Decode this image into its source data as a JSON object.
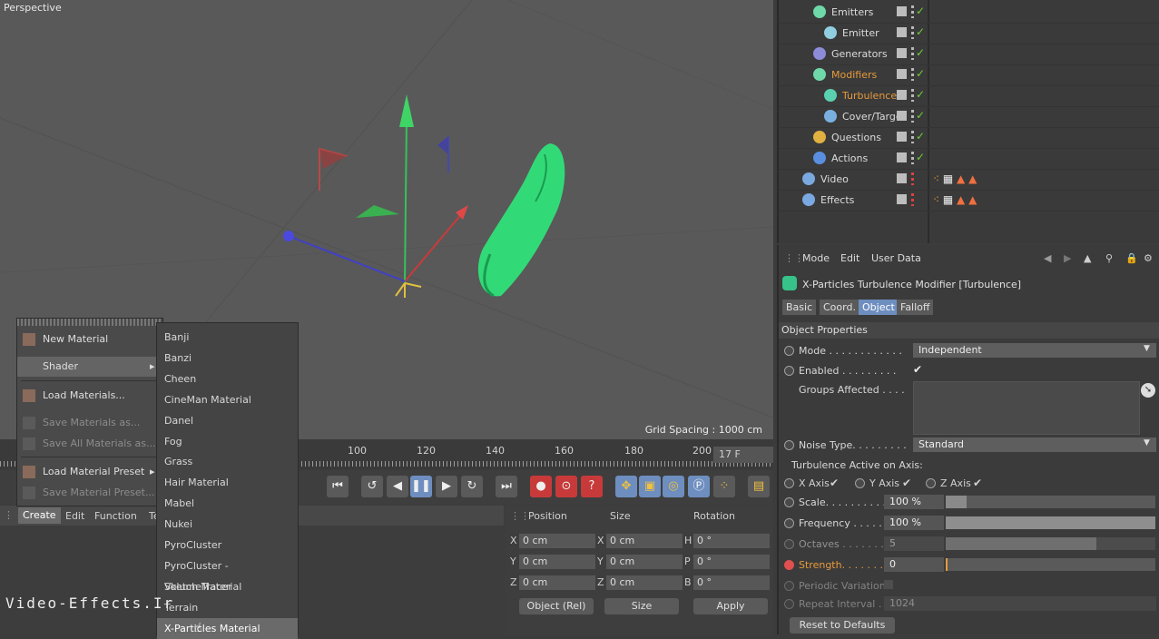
{
  "viewport": {
    "name": "Perspective",
    "grid_spacing": "Grid Spacing : 1000 cm"
  },
  "object_manager": {
    "items": [
      {
        "label": "Emitters",
        "indent": 1,
        "color": "#6fd8a8",
        "highlight": false
      },
      {
        "label": "Emitter",
        "indent": 2,
        "color": "#8fcfe0",
        "highlight": false
      },
      {
        "label": "Generators",
        "indent": 1,
        "color": "#8c8cd8",
        "highlight": false
      },
      {
        "label": "Modifiers",
        "indent": 1,
        "color": "#6fd8a8",
        "highlight": true
      },
      {
        "label": "Turbulence",
        "indent": 2,
        "color": "#5ad0b0",
        "highlight": true
      },
      {
        "label": "Cover/Target",
        "indent": 2,
        "color": "#7ab0e0",
        "highlight": false
      },
      {
        "label": "Questions",
        "indent": 1,
        "color": "#e0b040",
        "highlight": false
      },
      {
        "label": "Actions",
        "indent": 1,
        "color": "#5a8ee0",
        "highlight": false
      },
      {
        "label": "Video",
        "indent": 0,
        "color": "#7aa8e0",
        "highlight": false
      },
      {
        "label": "Effects",
        "indent": 0,
        "color": "#7aa8e0",
        "highlight": false
      }
    ]
  },
  "attribute_manager": {
    "menu": [
      "Mode",
      "Edit",
      "User Data"
    ],
    "title": "X-Particles Turbulence Modifier [Turbulence]",
    "tabs": [
      "Basic",
      "Coord.",
      "Object",
      "Falloff"
    ],
    "active_tab": "Object",
    "section": "Object Properties",
    "mode_label": "Mode . . . . . . . . . . . .",
    "mode_value": "Independent",
    "enabled_label": "Enabled . . . . . . . . .",
    "groups_label": "Groups Affected . . . .",
    "noise_label": "Noise Type. . . . . . . . .",
    "noise_value": "Standard",
    "axis_heading": "Turbulence Active on Axis:",
    "x_axis": "X Axis",
    "y_axis": "Y Axis",
    "z_axis": "Z Axis",
    "scale_label": "Scale. . . . . . . . . . . .",
    "scale_value": "100 %",
    "scale_pct": 10,
    "frequency_label": "Frequency . . . . . . . .",
    "frequency_value": "100 %",
    "frequency_pct": 100,
    "octaves_label": "Octaves . . . . . . . . .",
    "octaves_value": "5",
    "octaves_pct": 72,
    "strength_label": "Strength. . . . . . . . .",
    "strength_value": "0",
    "strength_pct": 0,
    "periodic_label": "Periodic Variation",
    "repeat_label": "Repeat Interval . .",
    "repeat_value": "1024",
    "reset_button": "Reset to Defaults"
  },
  "timeline": {
    "ticks": [
      "100",
      "120",
      "140",
      "160",
      "180",
      "200"
    ],
    "frame": "17 F"
  },
  "material_manager": {
    "menu": [
      "Create",
      "Edit",
      "Function",
      "Te"
    ]
  },
  "coordinates": {
    "headers": [
      "Position",
      "Size",
      "Rotation"
    ],
    "rows": [
      {
        "axis": "X",
        "pos": "0 cm",
        "size_axis": "X",
        "size": "0 cm",
        "rot_axis": "H",
        "rot": "0 °"
      },
      {
        "axis": "Y",
        "pos": "0 cm",
        "size_axis": "Y",
        "size": "0 cm",
        "rot_axis": "P",
        "rot": "0 °"
      },
      {
        "axis": "Z",
        "pos": "0 cm",
        "size_axis": "Z",
        "size": "0 cm",
        "rot_axis": "B",
        "rot": "0 °"
      }
    ],
    "mode_select": "Object (Rel)",
    "size_select": "Size",
    "apply": "Apply"
  },
  "create_menu": {
    "items": [
      {
        "label": "New Material",
        "state": "normal"
      },
      {
        "label": "Shader",
        "state": "hl"
      },
      {
        "label": "Load Materials...",
        "state": "normal"
      },
      {
        "label": "Save Materials as...",
        "state": "dis"
      },
      {
        "label": "Save All Materials as...",
        "state": "dis"
      },
      {
        "label": "Load Material Preset",
        "state": "normal"
      },
      {
        "label": "Save Material Preset...",
        "state": "dis"
      }
    ]
  },
  "shader_menu": {
    "items": [
      "Banji",
      "Banzi",
      "Cheen",
      "CineMan Material",
      "Danel",
      "Fog",
      "Grass",
      "Hair Material",
      "Mabel",
      "Nukei",
      "PyroCluster",
      "PyroCluster - VolumeTracer",
      "Sketch Material",
      "Terrain",
      "X-Particles Material"
    ],
    "highlighted": "X-Particles Material"
  },
  "watermark": "Video-Effects.Ir",
  "colors": {
    "accent": "#6e8ec0",
    "particles": "#2ee87a",
    "highlight_text": "#e89a3a"
  }
}
